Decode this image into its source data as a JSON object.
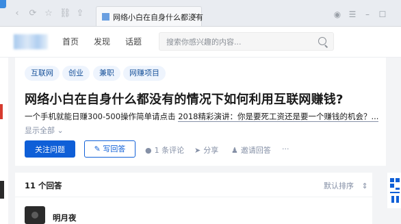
{
  "browser": {
    "tab_title": "网络小白在自身什么都没有",
    "tab_close": "×",
    "nav_icons": [
      "back-icon",
      "refresh-icon",
      "bookmark-star-icon",
      "link-icon",
      "share-icon"
    ],
    "right_icons": [
      "user-icon",
      "skin-icon",
      "menu-icon",
      "minimize-icon",
      "maximize-icon"
    ]
  },
  "header": {
    "nav": [
      "首页",
      "发现",
      "话题"
    ],
    "search_placeholder": "搜索你感兴趣的内容..."
  },
  "question": {
    "topics": [
      "互联网",
      "创业",
      "兼职",
      "网赚项目"
    ],
    "title": "网络小白在自身什么都没有的情况下如何利用互联网赚钱?",
    "detail_prefix": "一个手机就能日赚300-500操作简单请点击",
    "detail_link": "2018精彩演讲：你是要死工资还是要一个赚钱的机会？...",
    "show_all": "显示全部",
    "follow_label": "关注问题",
    "answer_label": "写回答",
    "comment_label": "1 条评论",
    "share_label": "分享",
    "invite_label": "邀请回答",
    "more_label": "···"
  },
  "answers": {
    "count_label": "11 个回答",
    "sort_label": "默认排序",
    "first_author": "明月夜"
  },
  "colors": {
    "accent": "#0f5fd7",
    "tag_bg": "#eef4fd",
    "tag_text": "#175199",
    "muted": "#8590a6"
  }
}
